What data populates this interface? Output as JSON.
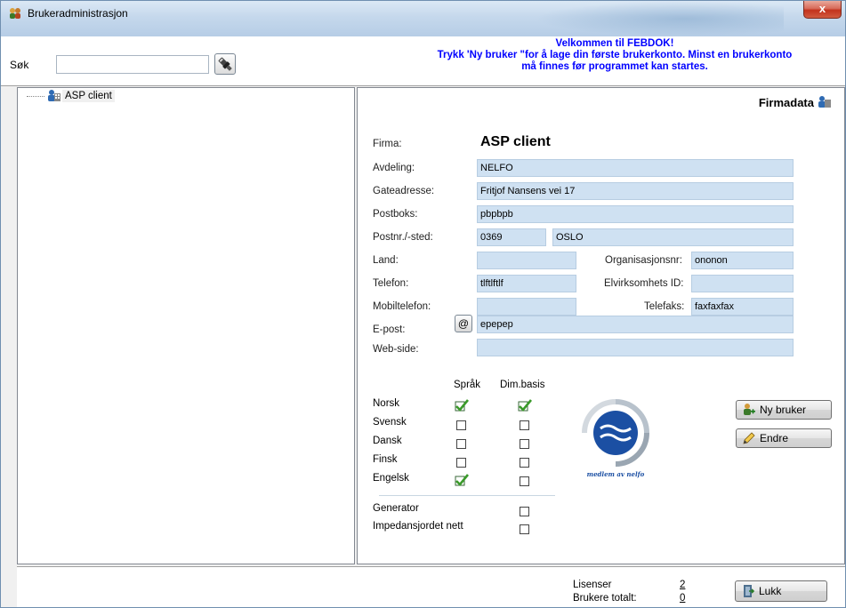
{
  "window": {
    "title": "Brukeradministrasjon",
    "close_label": "x"
  },
  "toolbar": {
    "search_label": "Søk",
    "search_value": "",
    "welcome_line1": "Velkommen til FEBDOK!",
    "welcome_line2": "Trykk 'Ny bruker \"for å lage din første brukerkonto. Minst en brukerkonto",
    "welcome_line3": "må finnes før programmet kan startes."
  },
  "tree": {
    "items": [
      {
        "label": "ASP client"
      }
    ]
  },
  "detail": {
    "header": "Firmadata",
    "firma_label": "Firma:",
    "firma_value": "ASP client",
    "avdeling_label": "Avdeling:",
    "avdeling_value": "NELFO",
    "gateadresse_label": "Gateadresse:",
    "gateadresse_value": "Fritjof Nansens vei 17",
    "postboks_label": "Postboks:",
    "postboks_value": "pbpbpb",
    "postnr_label": "Postnr./-sted:",
    "postnr_value": "0369",
    "sted_value": "OSLO",
    "land_label": "Land:",
    "land_value": "",
    "orgnr_label": "Organisasjonsnr:",
    "orgnr_value": "ononon",
    "telefon_label": "Telefon:",
    "telefon_value": "tlftlftlf",
    "elvirk_label": "Elvirksomhets ID:",
    "elvirk_value": "",
    "mobil_label": "Mobiltelefon:",
    "mobil_value": "",
    "telefaks_label": "Telefaks:",
    "telefaks_value": "faxfaxfax",
    "epost_label": "E-post:",
    "epost_button": "@",
    "epost_value": "epepep",
    "web_label": "Web-side:",
    "web_value": ""
  },
  "languages": {
    "col_sprak": "Språk",
    "col_dim": "Dim.basis",
    "rows": [
      {
        "label": "Norsk",
        "sprak": true,
        "dim": true
      },
      {
        "label": "Svensk",
        "sprak": false,
        "dim": false
      },
      {
        "label": "Dansk",
        "sprak": false,
        "dim": false
      },
      {
        "label": "Finsk",
        "sprak": false,
        "dim": false
      },
      {
        "label": "Engelsk",
        "sprak": true,
        "dim": false
      }
    ],
    "generator_label": "Generator",
    "generator_checked": false,
    "impedans_label": "Impedansjordet nett",
    "impedans_checked": false
  },
  "logo": {
    "text": "medlem av nelfo"
  },
  "buttons": {
    "ny_bruker": "Ny bruker",
    "endre": "Endre",
    "lukk": "Lukk"
  },
  "footer": {
    "lisenser_label": "Lisenser",
    "lisenser_value": "2",
    "brukere_label": "Brukere totalt:",
    "brukere_value": "0"
  },
  "colors": {
    "accent": "#0000ff",
    "field_bg": "#cfe1f2",
    "check_green": "#3a9a2a"
  }
}
